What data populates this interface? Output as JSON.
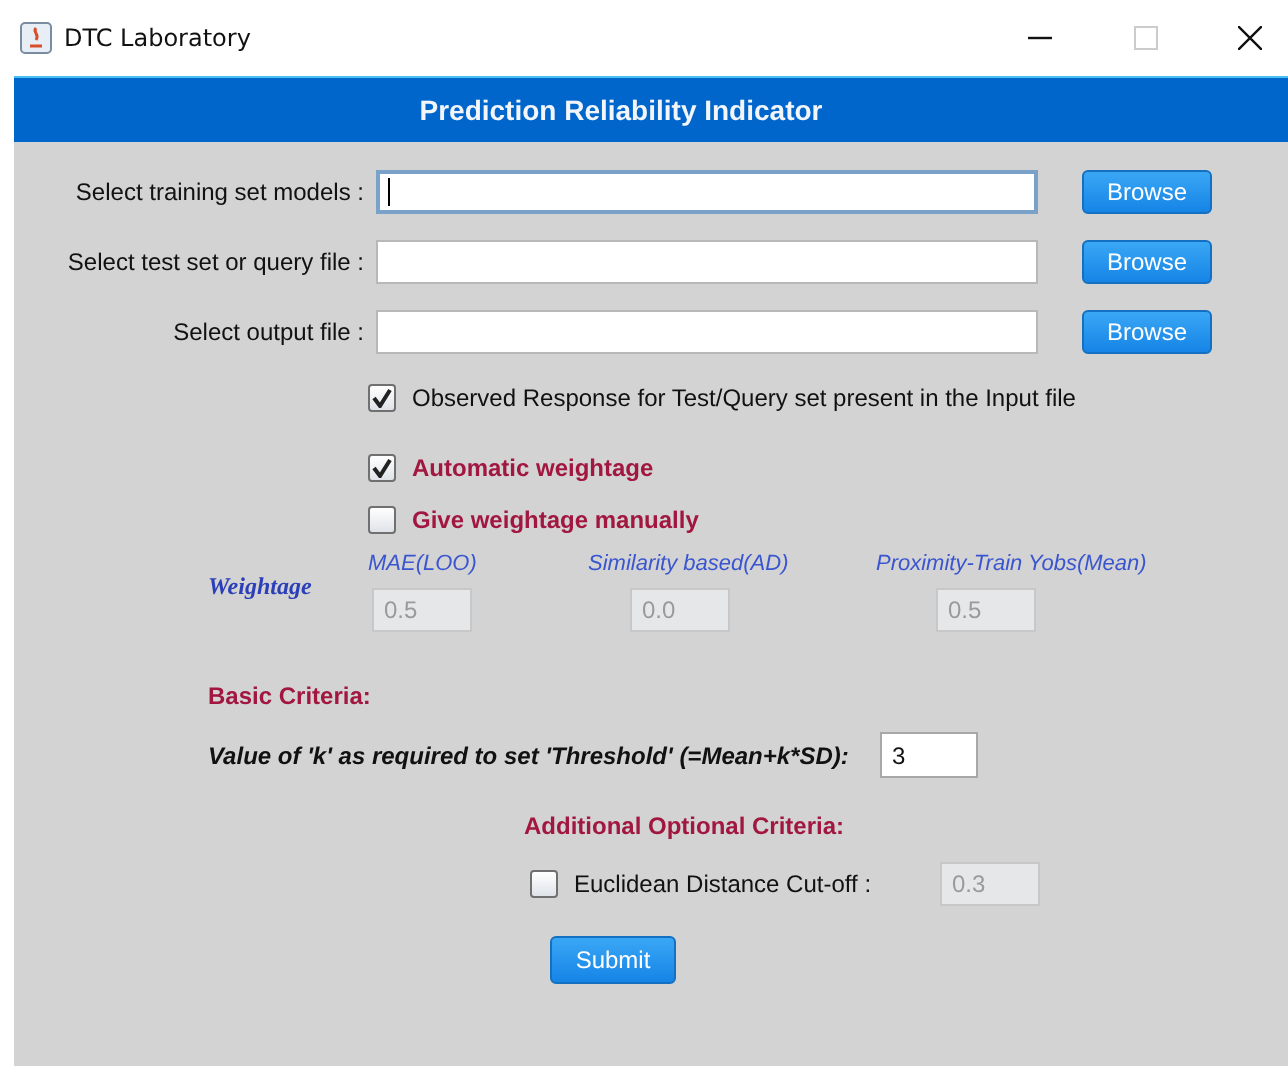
{
  "window": {
    "title": "DTC Laboratory"
  },
  "header": {
    "title": "Prediction Reliability Indicator"
  },
  "file_rows": [
    {
      "label": "Select training set models :",
      "value": "",
      "focused": true,
      "button": "Browse"
    },
    {
      "label": "Select test set or query file :",
      "value": "",
      "focused": false,
      "button": "Browse"
    },
    {
      "label": "Select output file :",
      "value": "",
      "focused": false,
      "button": "Browse"
    }
  ],
  "observed_checkbox": {
    "label": "Observed Response for Test/Query set present in the Input file",
    "checked": true
  },
  "weightage_options": [
    {
      "label": "Automatic weightage",
      "checked": true
    },
    {
      "label": "Give weightage manually",
      "checked": false
    }
  ],
  "weightage": {
    "label": "Weightage",
    "columns": [
      {
        "label": "MAE(LOO)",
        "value": "0.5",
        "disabled": true
      },
      {
        "label": "Similarity based(AD)",
        "value": "0.0",
        "disabled": true
      },
      {
        "label": "Proximity-Train Yobs(Mean)",
        "value": "0.5",
        "disabled": true
      }
    ]
  },
  "basic_criteria": {
    "heading": "Basic Criteria:",
    "k_label": "Value of 'k' as required to set 'Threshold' (=Mean+k*SD):",
    "k_value": "3"
  },
  "additional_criteria": {
    "heading": "Additional Optional Criteria:",
    "euclidean": {
      "label": "Euclidean Distance Cut-off :",
      "checked": false,
      "value": "0.3",
      "disabled": true
    }
  },
  "submit": "Submit"
}
